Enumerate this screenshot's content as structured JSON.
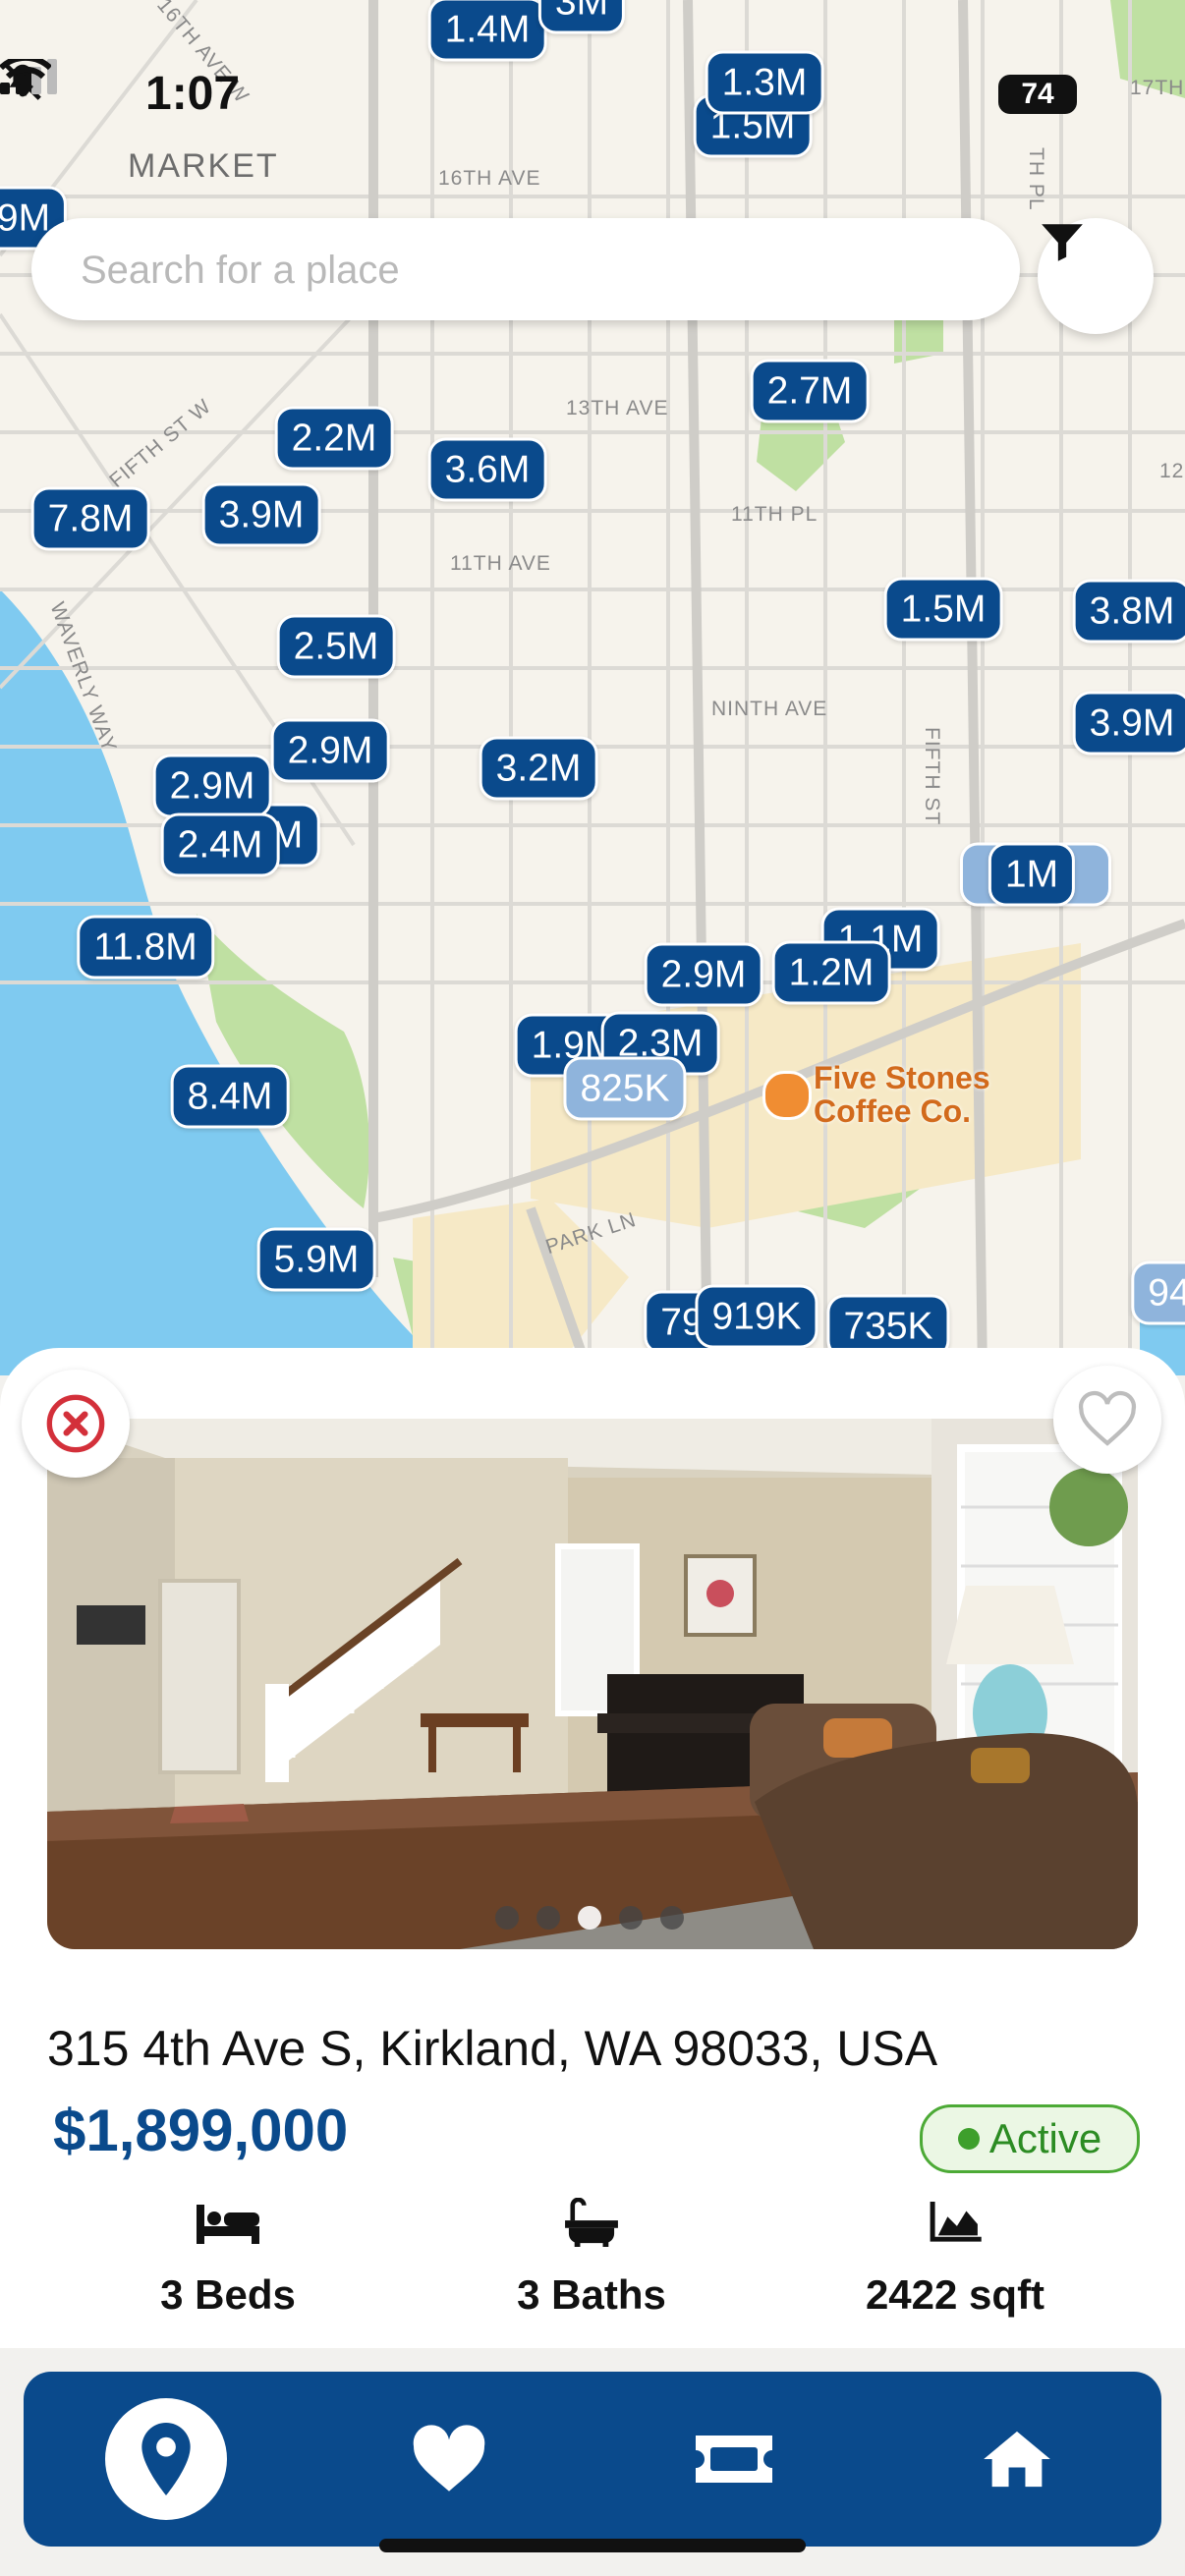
{
  "status_bar": {
    "time": "1:07",
    "battery": "74"
  },
  "map": {
    "neighborhood_label": "MARKET",
    "street_labels": [
      "16TH AVE",
      "13TH AVE",
      "11TH PL",
      "11TH AVE",
      "NINTH AVE",
      "FIFTH ST",
      "FIFTH ST W",
      "WAVERLY WAY",
      "PARK LN",
      "16TH AVE W",
      "17TH",
      "TH PL",
      "12"
    ],
    "pins": [
      {
        "label": "1.4M"
      },
      {
        "label": "3M"
      },
      {
        "label": "1.3M"
      },
      {
        "label": "1.5M"
      },
      {
        "label": "9M"
      },
      {
        "label": "2.7M"
      },
      {
        "label": "2.2M"
      },
      {
        "label": "3.6M"
      },
      {
        "label": "7.8M"
      },
      {
        "label": "3.9M"
      },
      {
        "label": "1.5M"
      },
      {
        "label": "3.8M"
      },
      {
        "label": "2.5M"
      },
      {
        "label": "3.9M"
      },
      {
        "label": "2.9M"
      },
      {
        "label": "2.9M"
      },
      {
        "label": "3.2M"
      },
      {
        "label": "2.4M"
      },
      {
        "label": "M"
      },
      {
        "label": "1M"
      },
      {
        "label": "11.8M"
      },
      {
        "label": "1.1M"
      },
      {
        "label": "2.9M"
      },
      {
        "label": "1.2M"
      },
      {
        "label": "1.9M"
      },
      {
        "label": "2.3M"
      },
      {
        "label": "825K"
      },
      {
        "label": "8.4M"
      },
      {
        "label": "5.9M"
      },
      {
        "label": "919K"
      },
      {
        "label": "735K"
      },
      {
        "label": "79"
      },
      {
        "label": "94"
      }
    ],
    "poi": {
      "name": "Five Stones\nCoffee Co."
    }
  },
  "search": {
    "placeholder": "Search for a place",
    "value": ""
  },
  "listing": {
    "address": "315 4th Ave S, Kirkland, WA 98033, USA",
    "price": "$1,899,000",
    "status": "Active",
    "beds": "3 Beds",
    "baths": "3 Baths",
    "area": "2422 sqft",
    "photo_count": 5,
    "current_photo_index": 3
  },
  "colors": {
    "brand": "#0a4a8c",
    "active_green": "#3e9f2c",
    "close_red": "#d3303a"
  },
  "icons": {
    "filter": "funnel-icon",
    "close": "circle-x-icon",
    "favorite": "heart-outline-icon",
    "beds": "bed-icon",
    "baths": "bathtub-icon",
    "area": "area-chart-icon",
    "nav": [
      "map-pin-icon",
      "heart-icon",
      "ticket-icon",
      "home-icon"
    ]
  }
}
